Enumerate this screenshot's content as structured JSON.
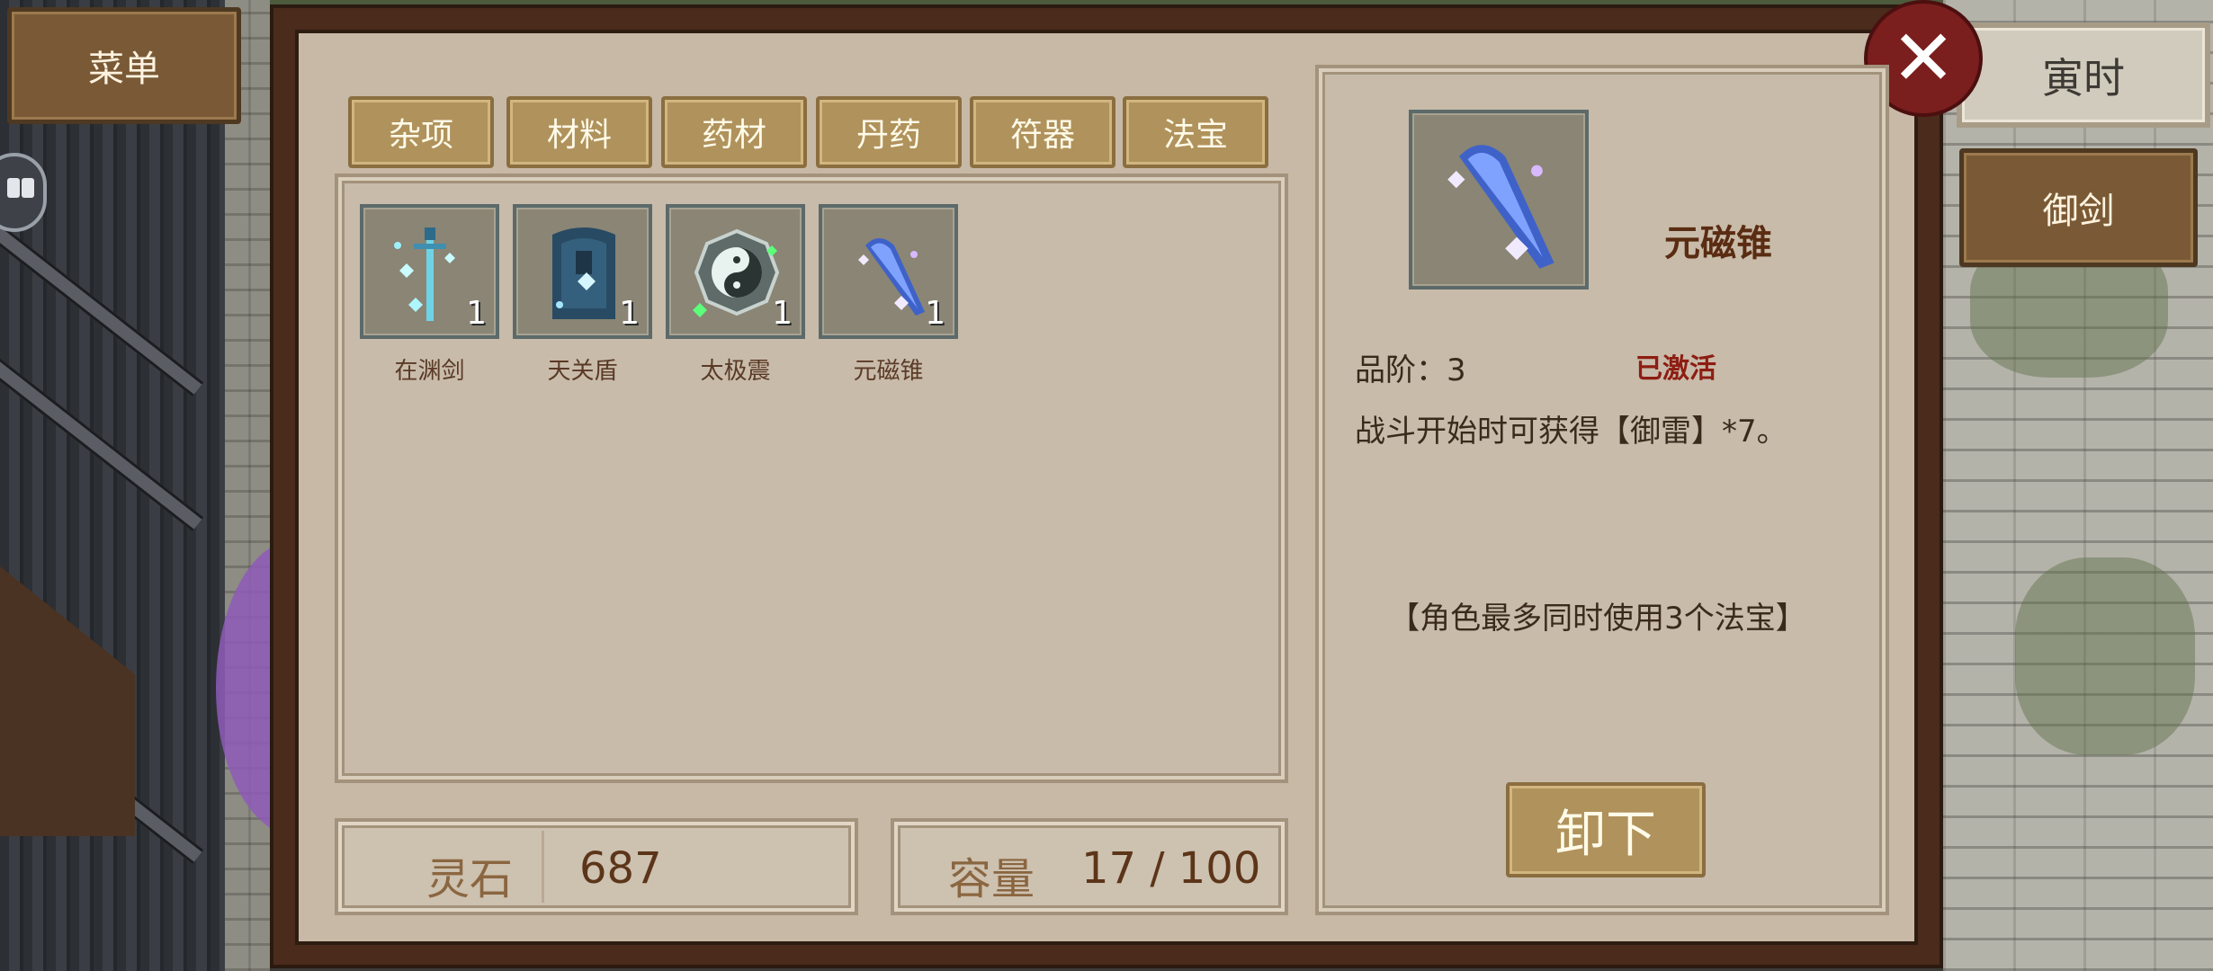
{
  "menu": {
    "label": "菜单"
  },
  "time": {
    "label": "寅时"
  },
  "side": {
    "fly_sword_label": "御剑"
  },
  "close": {
    "glyph": "✕"
  },
  "tabs": [
    {
      "label": "杂项"
    },
    {
      "label": "材料"
    },
    {
      "label": "药材"
    },
    {
      "label": "丹药"
    },
    {
      "label": "符器"
    },
    {
      "label": "法宝"
    }
  ],
  "items": [
    {
      "name": "在渊剑",
      "count": "1",
      "icon": "sword-icon"
    },
    {
      "name": "天关盾",
      "count": "1",
      "icon": "shield-icon"
    },
    {
      "name": "太极震",
      "count": "1",
      "icon": "taiji-icon"
    },
    {
      "name": "元磁锥",
      "count": "1",
      "icon": "cone-icon"
    }
  ],
  "stats": {
    "spirit_stone_label": "灵石",
    "spirit_stone_value": "687",
    "capacity_label": "容量",
    "capacity_value": "17 / 100"
  },
  "detail": {
    "name": "元磁锥",
    "grade": "品阶：3",
    "status": "已激活",
    "description": "战斗开始时可获得【御雷】*7。",
    "note": "【角色最多同时使用3个法宝】",
    "unequip_label": "卸下"
  },
  "colors": {
    "panel_border": "#4a2b1c",
    "panel_bg": "#c7b9a6",
    "tab_gold": "#b0925c",
    "close_red": "#7b1e1e",
    "status_red": "#8d1d12"
  }
}
